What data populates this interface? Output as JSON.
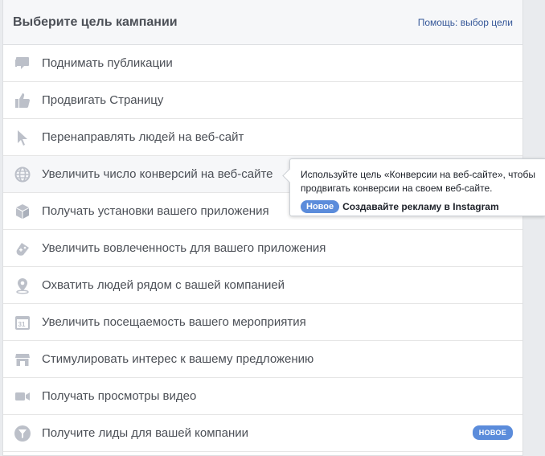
{
  "header": {
    "title": "Выберите цель кампании",
    "help_link": "Помощь: выбор цели"
  },
  "objectives": [
    {
      "label": "Поднимать публикации",
      "icon": "post-icon"
    },
    {
      "label": "Продвигать Страницу",
      "icon": "thumbs-up-icon"
    },
    {
      "label": "Перенаправлять людей на веб-сайт",
      "icon": "cursor-icon"
    },
    {
      "label": "Увеличить число конверсий на веб-сайте",
      "icon": "globe-icon"
    },
    {
      "label": "Получать установки вашего приложения",
      "icon": "box-icon"
    },
    {
      "label": "Увеличить вовлеченность для вашего приложения",
      "icon": "gamepad-icon"
    },
    {
      "label": "Охватить людей рядом с вашей компанией",
      "icon": "location-pin-icon"
    },
    {
      "label": "Увеличить посещаемость вашего мероприятия",
      "icon": "calendar-icon"
    },
    {
      "label": "Стимулировать интерес к вашему предложению",
      "icon": "store-icon"
    },
    {
      "label": "Получать просмотры видео",
      "icon": "video-camera-icon"
    },
    {
      "label": "Получите лиды для вашей компании",
      "icon": "funnel-icon",
      "badge": "НОВОЕ"
    }
  ],
  "tooltip": {
    "description": "Используйте цель «Конверсии на веб-сайте», чтобы продвигать конверсии на своем веб-сайте.",
    "new_label": "Новое",
    "instagram_text": "Создавайте рекламу в Instagram"
  },
  "colors": {
    "icon": "#bcc0c9",
    "badge": "#5b8cdb",
    "link": "#365899",
    "text": "#4b4f56"
  }
}
